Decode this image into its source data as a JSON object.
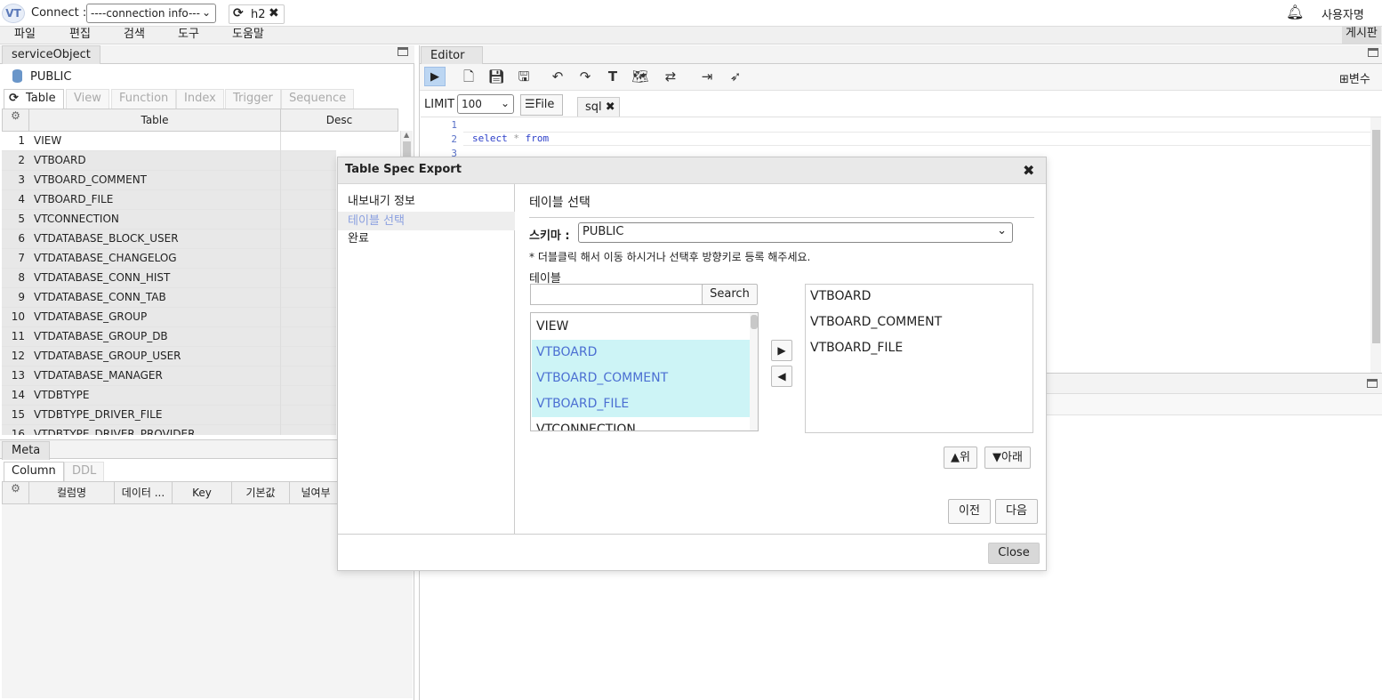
{
  "topbar": {
    "logo": "VT",
    "connect_label": "Connect :",
    "connection_select": "----connection info---",
    "active_conn_tab": "h2",
    "user_name": "사용자명"
  },
  "menu": [
    "파일",
    "편집",
    "검색",
    "도구",
    "도움말"
  ],
  "board_label": "게시판",
  "left_panel": {
    "tab_label": "serviceObject",
    "schema": "PUBLIC",
    "object_tabs": [
      "Table",
      "View",
      "Function",
      "Index",
      "Trigger",
      "Sequence"
    ],
    "grid_headers": {
      "table": "Table",
      "desc": "Desc"
    },
    "rows": [
      {
        "num": "1",
        "name": "VIEW",
        "selected": false
      },
      {
        "num": "2",
        "name": "VTBOARD",
        "selected": true
      },
      {
        "num": "3",
        "name": "VTBOARD_COMMENT",
        "selected": true
      },
      {
        "num": "4",
        "name": "VTBOARD_FILE",
        "selected": true
      },
      {
        "num": "5",
        "name": "VTCONNECTION",
        "selected": true
      },
      {
        "num": "6",
        "name": "VTDATABASE_BLOCK_USER",
        "selected": true
      },
      {
        "num": "7",
        "name": "VTDATABASE_CHANGELOG",
        "selected": true
      },
      {
        "num": "8",
        "name": "VTDATABASE_CONN_HIST",
        "selected": true
      },
      {
        "num": "9",
        "name": "VTDATABASE_CONN_TAB",
        "selected": true
      },
      {
        "num": "10",
        "name": "VTDATABASE_GROUP",
        "selected": true
      },
      {
        "num": "11",
        "name": "VTDATABASE_GROUP_DB",
        "selected": true
      },
      {
        "num": "12",
        "name": "VTDATABASE_GROUP_USER",
        "selected": true
      },
      {
        "num": "13",
        "name": "VTDATABASE_MANAGER",
        "selected": true
      },
      {
        "num": "14",
        "name": "VTDBTYPE",
        "selected": true
      },
      {
        "num": "15",
        "name": "VTDBTYPE_DRIVER_FILE",
        "selected": true
      },
      {
        "num": "16",
        "name": "VTDBTYPE_DRIVER_PROVIDER",
        "selected": true
      }
    ],
    "meta_tab": "Meta",
    "meta_subtabs": [
      "Column",
      "DDL"
    ],
    "meta_headers": [
      "컬럼명",
      "데이터 ...",
      "Key",
      "기본값",
      "널여부"
    ]
  },
  "editor": {
    "tab_label": "Editor",
    "var_button": "⊞변수",
    "limit_label": "LIMIT",
    "limit_value": "100",
    "file_button": "File",
    "sql_tab": "sql",
    "line_numbers": [
      "1",
      "2",
      "3"
    ],
    "code_keyword": "select",
    "code_star": "*",
    "code_from": "from"
  },
  "modal": {
    "title": "Table Spec Export",
    "steps": [
      "내보내기 정보",
      "테이블 선택",
      "완료"
    ],
    "active_step": 1,
    "section_title": "테이블 선택",
    "schema_label": "스키마 :",
    "schema_value": "PUBLIC",
    "hint": "* 더블클릭 해서 이동 하시거나 선택후 방향키로 등록 해주세요.",
    "table_label": "테이블",
    "search_placeholder": "",
    "search_button": "Search",
    "source_items": [
      {
        "name": "VIEW",
        "highlighted": false
      },
      {
        "name": "VTBOARD",
        "highlighted": true
      },
      {
        "name": "VTBOARD_COMMENT",
        "highlighted": true
      },
      {
        "name": "VTBOARD_FILE",
        "highlighted": true
      },
      {
        "name": "VTCONNECTION",
        "highlighted": false
      }
    ],
    "target_items": [
      "VTBOARD",
      "VTBOARD_COMMENT",
      "VTBOARD_FILE"
    ],
    "up_button": "▲위",
    "down_button": "▼아래",
    "prev_button": "이전",
    "next_button": "다음",
    "close_button": "Close"
  },
  "colors": {
    "highlight_bg": "#cdf4f6",
    "highlight_text": "#4b6fd2",
    "active_step_text": "#8ba0e0",
    "sql_keyword": "#2c3fc9"
  }
}
